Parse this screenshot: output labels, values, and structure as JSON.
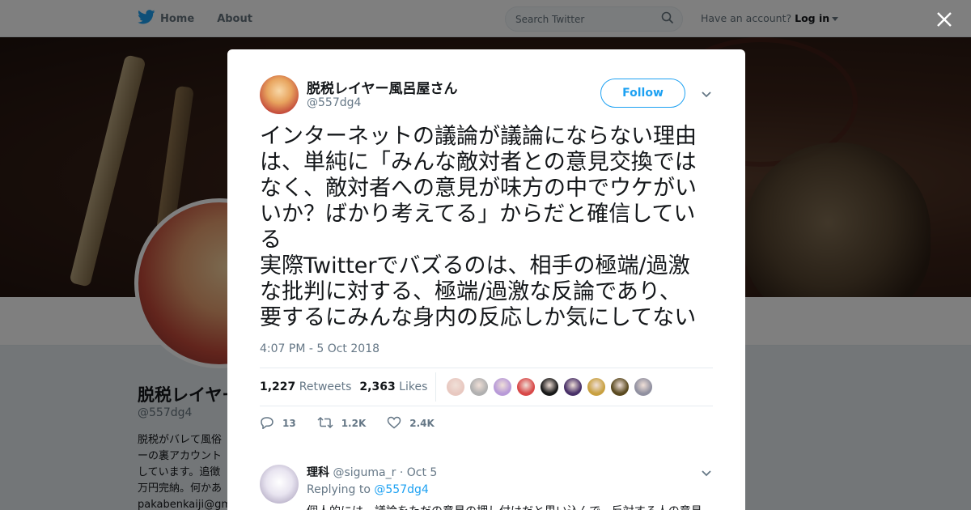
{
  "nav": {
    "home_label": "Home",
    "about_label": "About",
    "search_placeholder": "Search Twitter",
    "account_prompt": "Have an account?",
    "login_label": "Log in"
  },
  "profile": {
    "name": "脱税レイヤー",
    "handle": "@557dg4",
    "bio_lines": [
      "脱税がバレて風俗",
      "ーの裏アカウント",
      "しています。追徴",
      "万円完納。何かあ",
      "pakabenkaiji@gm"
    ]
  },
  "tweet": {
    "author_name": "脱税レイヤー風呂屋さん",
    "author_handle": "@557dg4",
    "follow_label": "Follow",
    "text_lines": [
      "インターネットの議論が議論にならない理由",
      "は、単純に「みんな敵対者との意見交換では",
      "なく、敵対者への意見が味方の中でウケがい",
      "いか？ばかり考えてる」からだと確信してい",
      "る",
      "実際Twitterでバズるのは、相手の極端/過激",
      "な批判に対する、極端/過激な反論であり、",
      "要するにみんな身内の反応しか気にしてない"
    ],
    "timestamp": "4:07 PM - 5 Oct 2018",
    "retweets_count": "1,227",
    "retweets_label": "Retweets",
    "likes_count": "2,363",
    "likes_label": "Likes",
    "reply_action_count": "13",
    "retweet_action_count": "1.2K",
    "like_action_count": "2.4K"
  },
  "liker_faces": [
    {
      "name": "liker-1",
      "color": "#e8c8c0"
    },
    {
      "name": "liker-2",
      "color": "#b0b0b0"
    },
    {
      "name": "liker-3",
      "color": "#b89ad8"
    },
    {
      "name": "liker-4",
      "color": "#d84848"
    },
    {
      "name": "liker-5",
      "color": "#181818"
    },
    {
      "name": "liker-6",
      "color": "#483068"
    },
    {
      "name": "liker-7",
      "color": "#c8a040"
    },
    {
      "name": "liker-8",
      "color": "#5a4a20"
    },
    {
      "name": "liker-9",
      "color": "#9090a0"
    }
  ],
  "reply": {
    "author_name": "理科",
    "author_handle": "@siguma_r",
    "date": "· Oct 5",
    "replying_prefix": "Replying to",
    "replying_to": "@557dg4",
    "text": "個人的には、議論をただの意見の押し付けだと思い込んで、反対する人の意見"
  },
  "colors": {
    "accent": "#1da1f2",
    "text": "#14171a",
    "muted": "#657786"
  }
}
